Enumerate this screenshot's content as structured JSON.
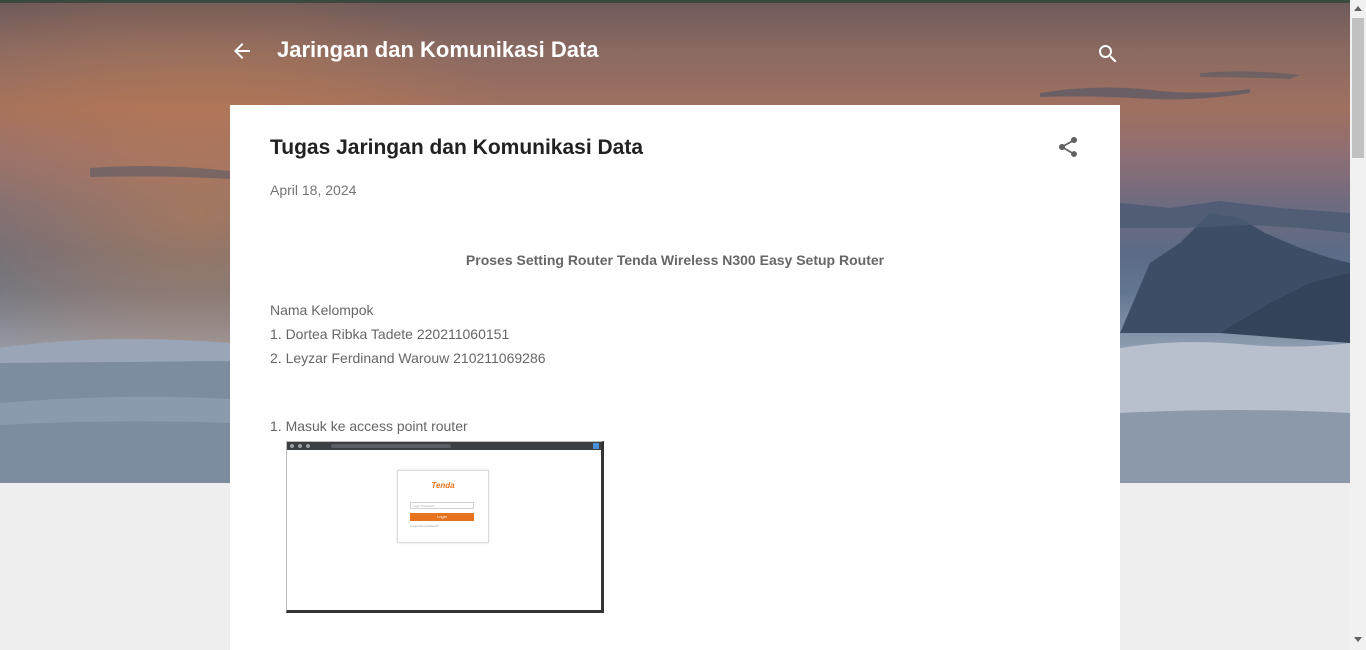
{
  "blog": {
    "title": "Jaringan dan Komunikasi Data",
    "back_icon": "arrow-left-icon",
    "search_icon": "search-icon"
  },
  "post": {
    "title": "Tugas Jaringan dan Komunikasi Data",
    "date": "April 18, 2024",
    "share_icon": "share-icon",
    "heading": "Proses Setting Router Tenda Wireless N300 Easy Setup Router",
    "team_label": "Nama Kelompok",
    "members": [
      "1. Dortea Ribka Tadete 220211060151",
      "2. Leyzar Ferdinand Warouw 210211069286"
    ],
    "step1": "1. Masuk ke access point router",
    "screenshot": {
      "logo_text": "Tenda",
      "password_placeholder": "Login Password",
      "login_button": "Login",
      "forgot_text": "Forget the password?"
    }
  },
  "colors": {
    "title_white": "#ffffff",
    "post_title": "#212121",
    "body_text": "#666666",
    "date_text": "#757575",
    "tenda_orange": "#e8731f"
  }
}
